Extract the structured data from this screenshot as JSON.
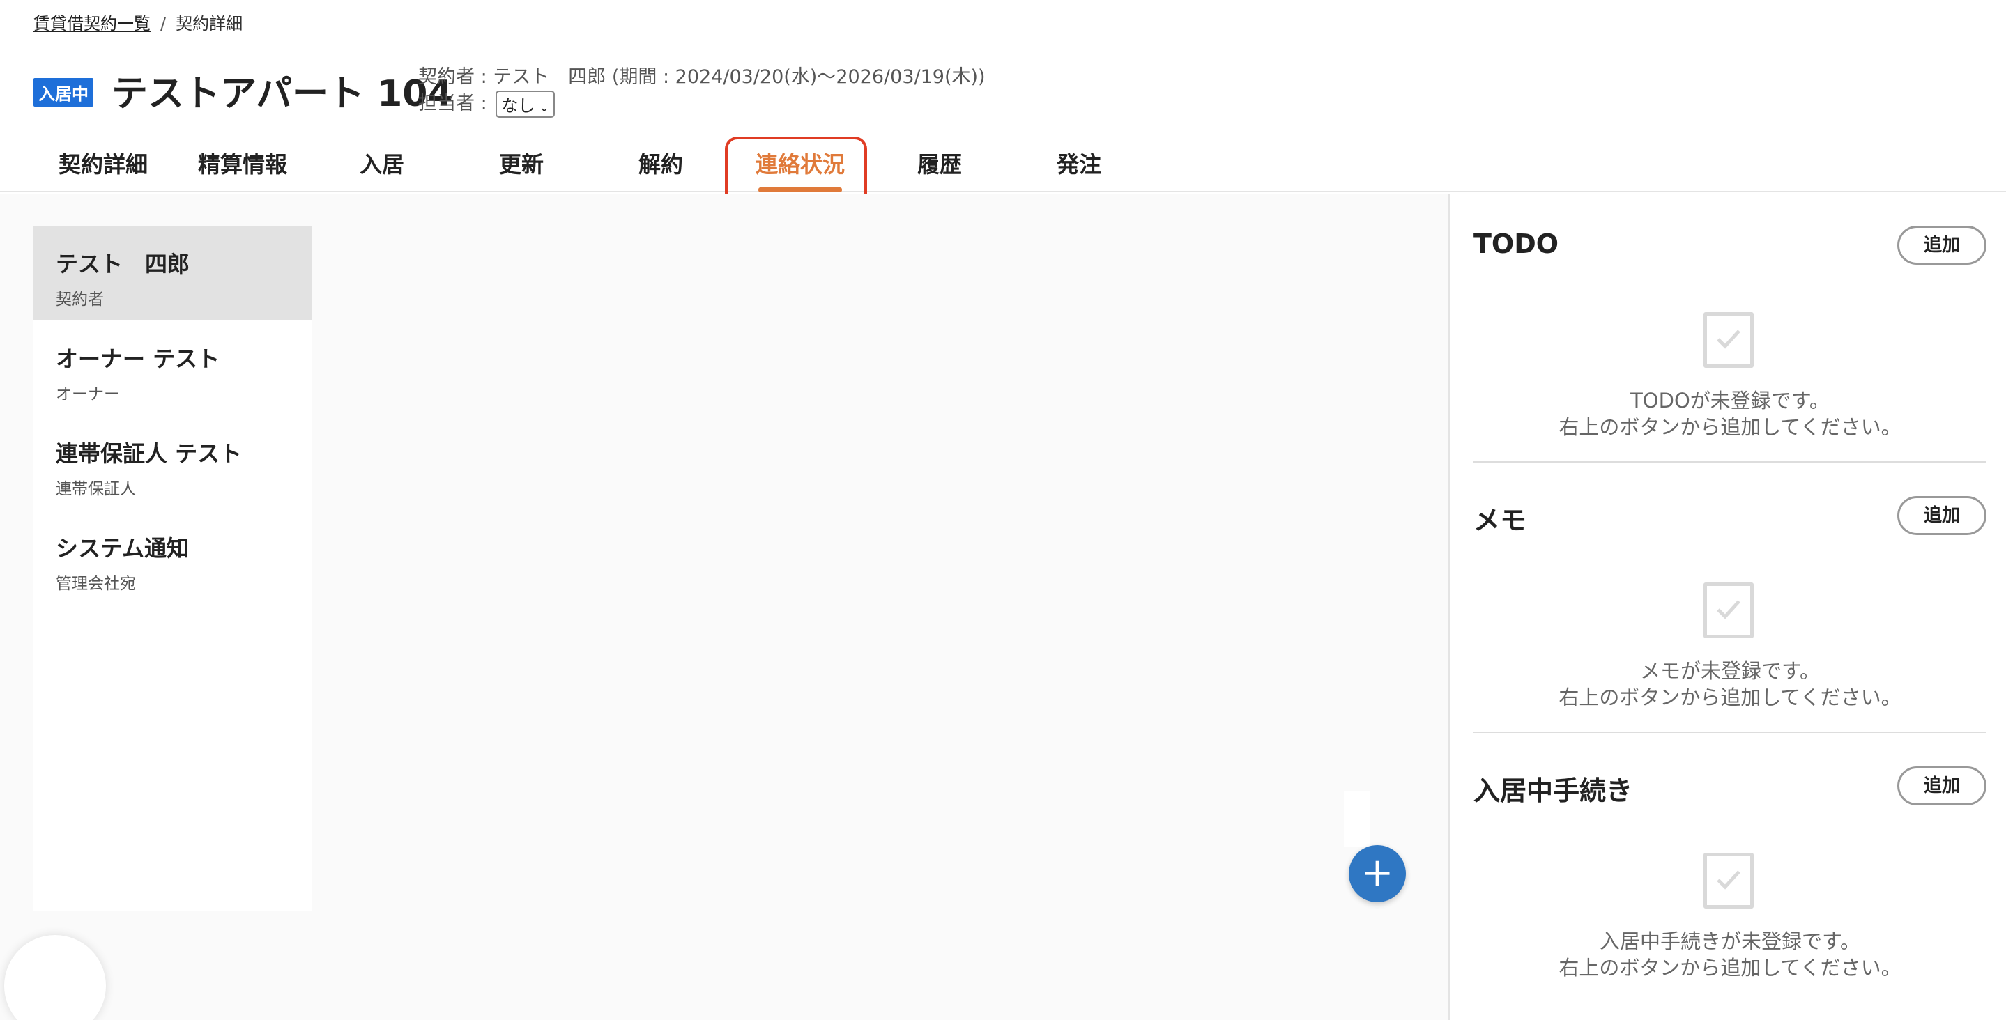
{
  "breadcrumb": {
    "parent": "賃貸借契約一覧",
    "separator": "/",
    "current": "契約詳細"
  },
  "header": {
    "status_badge": "入居中",
    "title": "テストアパート 104",
    "contract_info": "契約者 : テスト　四郎 (期間 : 2024/03/20(水)〜2026/03/19(木))",
    "assignee_label": "担当者 :",
    "assignee_value": "なし"
  },
  "tabs": [
    {
      "label": "契約詳細",
      "active": false
    },
    {
      "label": "精算情報",
      "active": false
    },
    {
      "label": "入居",
      "active": false
    },
    {
      "label": "更新",
      "active": false
    },
    {
      "label": "解約",
      "active": false
    },
    {
      "label": "連絡状況",
      "active": true
    },
    {
      "label": "履歴",
      "active": false
    },
    {
      "label": "発注",
      "active": false
    }
  ],
  "contacts": [
    {
      "name": "テスト　四郎",
      "role": "契約者",
      "selected": true
    },
    {
      "name": "オーナー テスト",
      "role": "オーナー",
      "selected": false
    },
    {
      "name": "連帯保証人 テスト",
      "role": "連帯保証人",
      "selected": false
    },
    {
      "name": "システム通知",
      "role": "管理会社宛",
      "selected": false
    }
  ],
  "fab": {
    "icon": "plus-icon",
    "label": "+"
  },
  "sidebar": {
    "panels": [
      {
        "title": "TODO",
        "add_label": "追加",
        "empty_line1": "TODOが未登録です。",
        "empty_line2": "右上のボタンから追加してください。"
      },
      {
        "title": "メモ",
        "add_label": "追加",
        "empty_line1": "メモが未登録です。",
        "empty_line2": "右上のボタンから追加してください。"
      },
      {
        "title": "入居中手続き",
        "add_label": "追加",
        "empty_line1": "入居中手続きが未登録です。",
        "empty_line2": "右上のボタンから追加してください。"
      }
    ]
  },
  "colors": {
    "accent": "#e07a3a",
    "badge": "#1e6fd9",
    "fab": "#2f77c3",
    "highlight": "#e03c24"
  }
}
